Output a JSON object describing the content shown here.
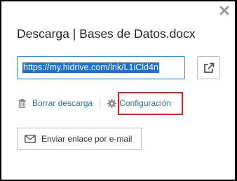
{
  "dialog": {
    "title": "Descarga | Bases de Datos.docx",
    "link_value": "https://my.hidrive.com/lnk/L1iCld4n",
    "actions": {
      "delete_label": "Borrar descarga",
      "separator": "|",
      "settings_label": "Configuración"
    },
    "email_button_label": "Enviar enlace por e-mail",
    "icons": {
      "close": "close-icon",
      "open_link": "external-link-icon",
      "delete": "trash-icon",
      "settings": "gear-icon",
      "email": "envelope-icon"
    },
    "colors": {
      "link": "#2c6fb5",
      "input_border": "#3b8edb",
      "selection": "#1b6fd6",
      "highlight": "#e31f26"
    }
  }
}
